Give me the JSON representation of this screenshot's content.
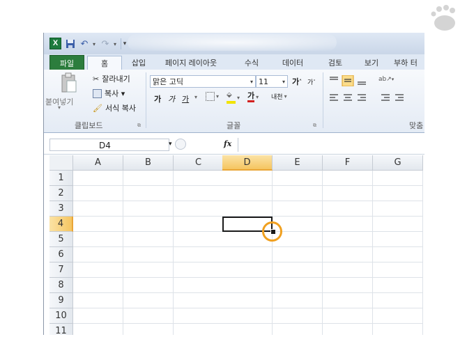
{
  "quick_access": {
    "undo_label": "↶",
    "redo_label": "↷",
    "customize_label": "▾"
  },
  "tabs": {
    "file": "파일",
    "home": "홈",
    "insert": "삽입",
    "page_layout": "페이지 레이아웃",
    "formulas": "수식",
    "data": "데이터",
    "review": "검토",
    "view": "보기",
    "more": "부하 터"
  },
  "ribbon": {
    "clipboard": {
      "paste": "붙여넣기",
      "cut": "잘라내기",
      "copy": "복사 ▾",
      "format_painter": "서식 복사",
      "group_label": "클립보드"
    },
    "font": {
      "font_name": "맑은 고딕",
      "font_size": "11",
      "grow": "가",
      "shrink": "가",
      "bold": "가",
      "italic": "가",
      "underline": "가",
      "font_color_letter": "가",
      "phonetic": "내천",
      "group_label": "글꼴"
    },
    "alignment": {
      "group_label": "맞춤"
    }
  },
  "formula_bar": {
    "name_box": "D4",
    "fx": "fx",
    "formula": ""
  },
  "sheet": {
    "columns": [
      "A",
      "B",
      "C",
      "D",
      "E",
      "F",
      "G"
    ],
    "rows": [
      "1",
      "2",
      "3",
      "4",
      "5",
      "6",
      "7",
      "8",
      "9",
      "10",
      "11"
    ],
    "active_cell": "D4",
    "active_column": "D",
    "active_row": "4"
  },
  "colors": {
    "file_tab": "#2c7d3d",
    "selection_header": "#f5c560",
    "highlight_circle": "#f0a020"
  }
}
